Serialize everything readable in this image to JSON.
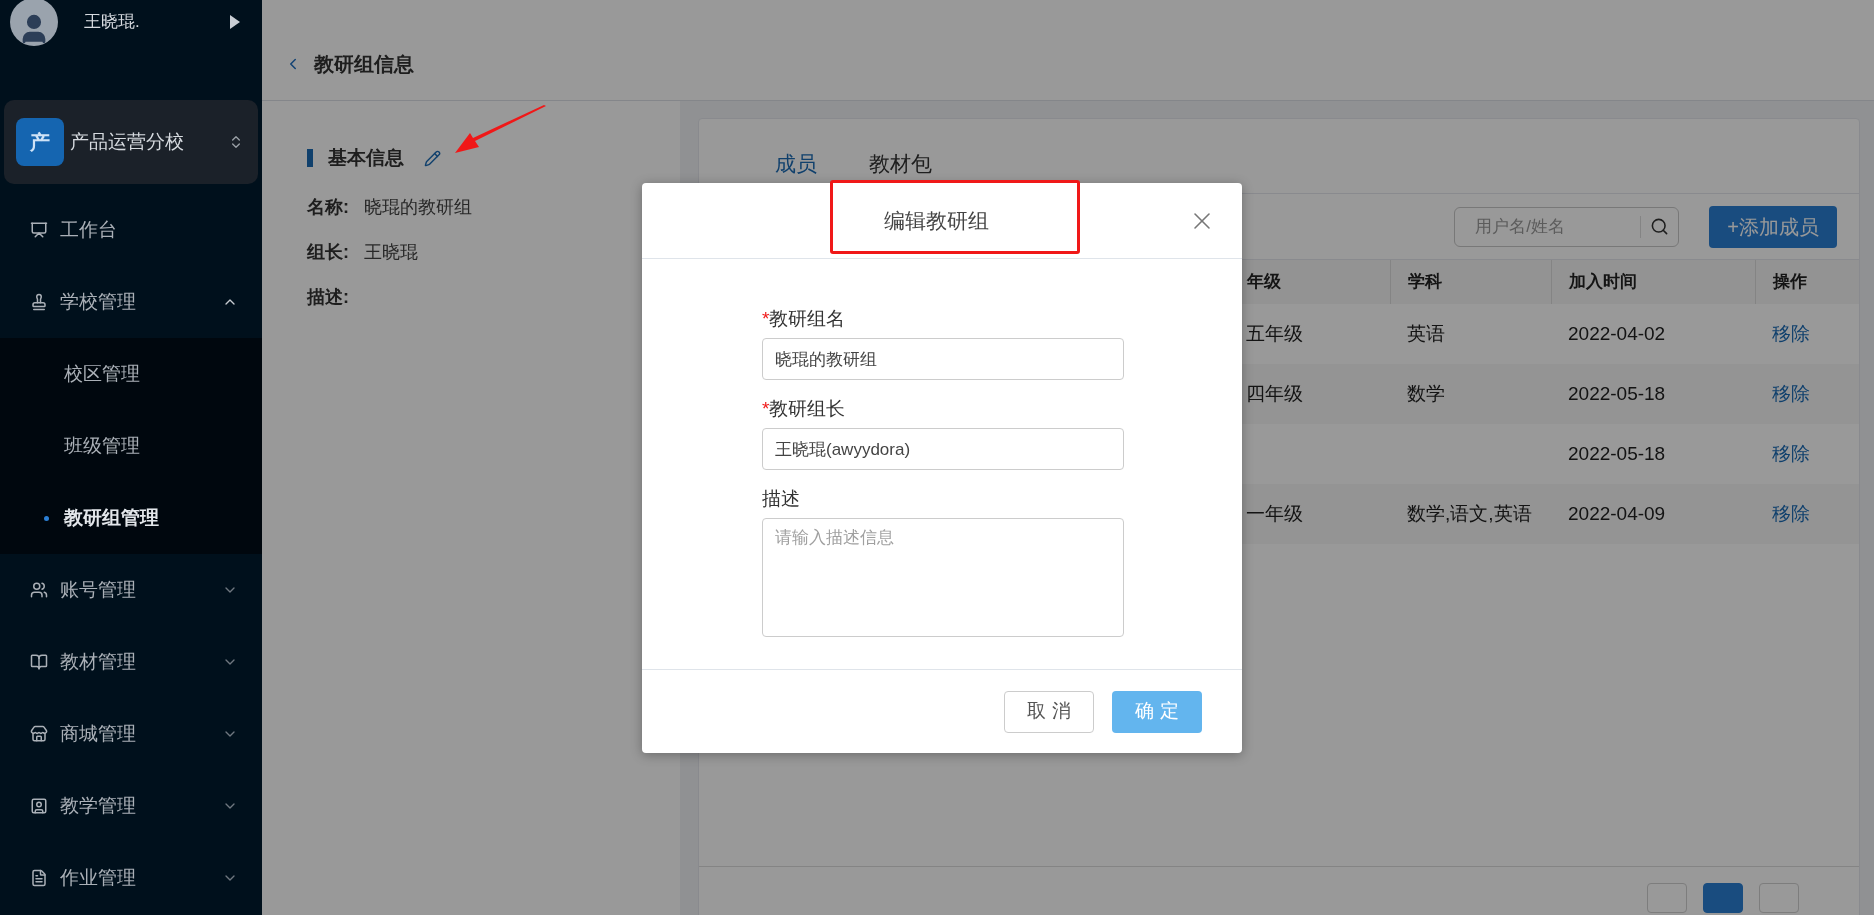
{
  "sidebar": {
    "user": {
      "name": "王晓琨."
    },
    "school": {
      "badge": "产",
      "name": "产品运营分校"
    },
    "items": [
      {
        "kind": "link",
        "label": "工作台"
      },
      {
        "kind": "group",
        "label": "学校管理",
        "expanded": true,
        "children": [
          {
            "label": "校区管理",
            "selected": false
          },
          {
            "label": "班级管理",
            "selected": false
          },
          {
            "label": "教研组管理",
            "selected": true
          }
        ]
      },
      {
        "kind": "group",
        "label": "账号管理",
        "expanded": false
      },
      {
        "kind": "group",
        "label": "教材管理",
        "expanded": false
      },
      {
        "kind": "group",
        "label": "商城管理",
        "expanded": false
      },
      {
        "kind": "group",
        "label": "教学管理",
        "expanded": false
      },
      {
        "kind": "group",
        "label": "作业管理",
        "expanded": false
      }
    ]
  },
  "page": {
    "title": "教研组信息"
  },
  "info": {
    "heading": "基本信息",
    "fields": [
      {
        "label": "名称:",
        "value": "晓琨的教研组"
      },
      {
        "label": "组长:",
        "value": "王晓琨"
      },
      {
        "label": "描述:"
      }
    ]
  },
  "tabs": [
    {
      "label": "成员",
      "selected": true
    },
    {
      "label": "教材包",
      "selected": false
    }
  ],
  "search": {
    "placeholder": "用户名/姓名"
  },
  "add_button": "+添加成员",
  "table": {
    "columns": [
      "年级",
      "学科",
      "加入时间",
      "操作"
    ],
    "rows": [
      [
        "五年级",
        "英语",
        "2022-04-02",
        "移除"
      ],
      [
        "四年级",
        "数学",
        "2022-05-18",
        "移除"
      ],
      [
        "",
        "",
        "2022-05-18",
        "移除"
      ],
      [
        "一年级",
        "数学,语文,英语",
        "2022-04-09",
        "移除"
      ]
    ]
  },
  "pagination": [
    {
      "selected": false
    },
    {
      "selected": true
    },
    {
      "selected": false
    }
  ],
  "dialog": {
    "title": "编辑教研组",
    "fields": [
      {
        "kind": "input",
        "required_mark": "*",
        "label": "教研组名",
        "value": "晓琨的教研组"
      },
      {
        "kind": "input",
        "required_mark": "*",
        "label": "教研组长",
        "value": "王晓琨(awyydora)"
      },
      {
        "kind": "textarea",
        "label": "描述",
        "placeholder": "请输入描述信息"
      }
    ],
    "buttons": [
      {
        "label": "取 消",
        "kind": "secondary"
      },
      {
        "label": "确 定",
        "kind": "primary"
      }
    ]
  }
}
